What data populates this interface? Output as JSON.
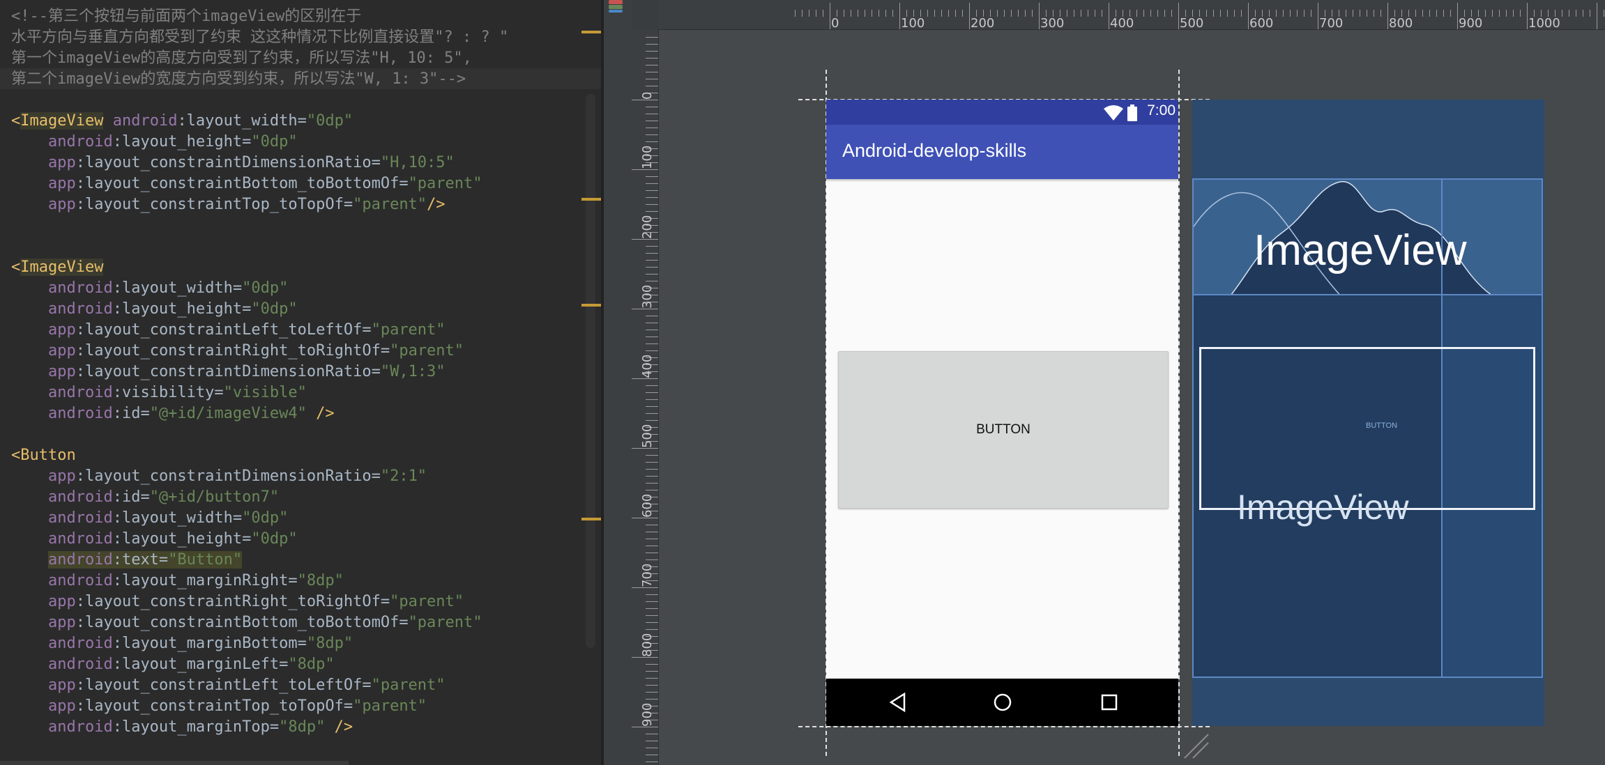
{
  "editor": {
    "lines": [
      {
        "segments": [
          {
            "t": "<!--第三个按钮与前面两个imageView的区别在于",
            "c": "comment"
          }
        ]
      },
      {
        "segments": [
          {
            "t": "水平方向与垂直方向都受到了约束 这这种情况下比例直接设置\"? : ? \"",
            "c": "comment"
          }
        ]
      },
      {
        "segments": [
          {
            "t": "第一个imageView的高度方向受到了约束，所以写法\"H, 10: 5\",",
            "c": "comment"
          }
        ]
      },
      {
        "segments": [
          {
            "t": "第二个imageView的宽度方向受到约束，所以写法\"W, 1: 3\"-->",
            "c": "comment"
          }
        ]
      },
      {
        "segments": []
      },
      {
        "segments": [
          {
            "t": "<",
            "c": "tag"
          },
          {
            "t": "ImageView",
            "c": "tag hl-word"
          },
          {
            "t": " "
          },
          {
            "t": "android",
            "c": "ns-android"
          },
          {
            "t": ":layout_width=",
            "c": "attr"
          },
          {
            "t": "\"0dp\"",
            "c": "val"
          }
        ]
      },
      {
        "segments": [
          {
            "t": "    "
          },
          {
            "t": "android",
            "c": "ns-android"
          },
          {
            "t": ":layout_height=",
            "c": "attr"
          },
          {
            "t": "\"0dp\"",
            "c": "val"
          }
        ]
      },
      {
        "segments": [
          {
            "t": "    "
          },
          {
            "t": "app",
            "c": "ns-app"
          },
          {
            "t": ":layout_constraintDimensionRatio=",
            "c": "attr"
          },
          {
            "t": "\"H,10:5\"",
            "c": "val"
          }
        ]
      },
      {
        "segments": [
          {
            "t": "    "
          },
          {
            "t": "app",
            "c": "ns-app"
          },
          {
            "t": ":layout_constraintBottom_toBottomOf=",
            "c": "attr"
          },
          {
            "t": "\"parent\"",
            "c": "val"
          }
        ]
      },
      {
        "segments": [
          {
            "t": "    "
          },
          {
            "t": "app",
            "c": "ns-app"
          },
          {
            "t": ":layout_constraintTop_toTopOf=",
            "c": "attr"
          },
          {
            "t": "\"parent\"",
            "c": "val"
          },
          {
            "t": "/>",
            "c": "tag"
          }
        ]
      },
      {
        "segments": []
      },
      {
        "segments": []
      },
      {
        "segments": [
          {
            "t": "<",
            "c": "tag"
          },
          {
            "t": "ImageView",
            "c": "tag hl-word"
          }
        ]
      },
      {
        "segments": [
          {
            "t": "    "
          },
          {
            "t": "android",
            "c": "ns-android"
          },
          {
            "t": ":layout_width=",
            "c": "attr"
          },
          {
            "t": "\"0dp\"",
            "c": "val"
          }
        ]
      },
      {
        "segments": [
          {
            "t": "    "
          },
          {
            "t": "android",
            "c": "ns-android"
          },
          {
            "t": ":layout_height=",
            "c": "attr"
          },
          {
            "t": "\"0dp\"",
            "c": "val"
          }
        ]
      },
      {
        "segments": [
          {
            "t": "    "
          },
          {
            "t": "app",
            "c": "ns-app"
          },
          {
            "t": ":layout_constraintLeft_toLeftOf=",
            "c": "attr"
          },
          {
            "t": "\"parent\"",
            "c": "val"
          }
        ]
      },
      {
        "segments": [
          {
            "t": "    "
          },
          {
            "t": "app",
            "c": "ns-app"
          },
          {
            "t": ":layout_constraintRight_toRightOf=",
            "c": "attr"
          },
          {
            "t": "\"parent\"",
            "c": "val"
          }
        ]
      },
      {
        "segments": [
          {
            "t": "    "
          },
          {
            "t": "app",
            "c": "ns-app"
          },
          {
            "t": ":layout_constraintDimensionRatio=",
            "c": "attr"
          },
          {
            "t": "\"W,1:3\"",
            "c": "val"
          }
        ]
      },
      {
        "segments": [
          {
            "t": "    "
          },
          {
            "t": "android",
            "c": "ns-android"
          },
          {
            "t": ":visibility=",
            "c": "attr"
          },
          {
            "t": "\"visible\"",
            "c": "val"
          }
        ]
      },
      {
        "segments": [
          {
            "t": "    "
          },
          {
            "t": "android",
            "c": "ns-android"
          },
          {
            "t": ":id=",
            "c": "attr"
          },
          {
            "t": "\"@+id/imageView4\"",
            "c": "val"
          },
          {
            "t": " />",
            "c": "tag"
          }
        ]
      },
      {
        "segments": []
      },
      {
        "segments": [
          {
            "t": "<",
            "c": "tag"
          },
          {
            "t": "Button",
            "c": "tag"
          }
        ]
      },
      {
        "segments": [
          {
            "t": "    "
          },
          {
            "t": "app",
            "c": "ns-app"
          },
          {
            "t": ":layout_constraintDimensionRatio=",
            "c": "attr"
          },
          {
            "t": "\"2:1\"",
            "c": "val"
          }
        ]
      },
      {
        "segments": [
          {
            "t": "    "
          },
          {
            "t": "android",
            "c": "ns-android"
          },
          {
            "t": ":id=",
            "c": "attr"
          },
          {
            "t": "\"@+id/button7\"",
            "c": "val"
          }
        ]
      },
      {
        "segments": [
          {
            "t": "    "
          },
          {
            "t": "android",
            "c": "ns-android"
          },
          {
            "t": ":layout_width=",
            "c": "attr"
          },
          {
            "t": "\"0dp\"",
            "c": "val"
          }
        ]
      },
      {
        "segments": [
          {
            "t": "    "
          },
          {
            "t": "android",
            "c": "ns-android"
          },
          {
            "t": ":layout_height=",
            "c": "attr"
          },
          {
            "t": "\"0dp\"",
            "c": "val"
          }
        ]
      },
      {
        "segments": [
          {
            "t": "    "
          },
          {
            "t": "android",
            "c": "ns-android hl-attr"
          },
          {
            "t": ":text=",
            "c": "attr hl-attr"
          },
          {
            "t": "\"Button\"",
            "c": "val hl-attr"
          }
        ]
      },
      {
        "segments": [
          {
            "t": "    "
          },
          {
            "t": "android",
            "c": "ns-android"
          },
          {
            "t": ":layout_marginRight=",
            "c": "attr"
          },
          {
            "t": "\"8dp\"",
            "c": "val"
          }
        ]
      },
      {
        "segments": [
          {
            "t": "    "
          },
          {
            "t": "app",
            "c": "ns-app"
          },
          {
            "t": ":layout_constraintRight_toRightOf=",
            "c": "attr"
          },
          {
            "t": "\"parent\"",
            "c": "val"
          }
        ]
      },
      {
        "segments": [
          {
            "t": "    "
          },
          {
            "t": "app",
            "c": "ns-app"
          },
          {
            "t": ":layout_constraintBottom_toBottomOf=",
            "c": "attr"
          },
          {
            "t": "\"parent\"",
            "c": "val"
          }
        ]
      },
      {
        "segments": [
          {
            "t": "    "
          },
          {
            "t": "android",
            "c": "ns-android"
          },
          {
            "t": ":layout_marginBottom=",
            "c": "attr"
          },
          {
            "t": "\"8dp\"",
            "c": "val"
          }
        ]
      },
      {
        "segments": [
          {
            "t": "    "
          },
          {
            "t": "android",
            "c": "ns-android"
          },
          {
            "t": ":layout_marginLeft=",
            "c": "attr"
          },
          {
            "t": "\"8dp\"",
            "c": "val"
          }
        ]
      },
      {
        "segments": [
          {
            "t": "    "
          },
          {
            "t": "app",
            "c": "ns-app"
          },
          {
            "t": ":layout_constraintLeft_toLeftOf=",
            "c": "attr"
          },
          {
            "t": "\"parent\"",
            "c": "val"
          }
        ]
      },
      {
        "segments": [
          {
            "t": "    "
          },
          {
            "t": "app",
            "c": "ns-app"
          },
          {
            "t": ":layout_constraintTop_toTopOf=",
            "c": "attr"
          },
          {
            "t": "\"parent\"",
            "c": "val"
          }
        ]
      },
      {
        "segments": [
          {
            "t": "    "
          },
          {
            "t": "android",
            "c": "ns-android"
          },
          {
            "t": ":layout_marginTop=",
            "c": "attr"
          },
          {
            "t": "\"8dp\"",
            "c": "val"
          },
          {
            "t": " />",
            "c": "tag"
          }
        ]
      }
    ]
  },
  "rulers": {
    "horizontal_labels": [
      "0",
      "100",
      "200",
      "300",
      "400",
      "500",
      "600",
      "700",
      "800",
      "900",
      "1000"
    ],
    "vertical_labels": [
      "0",
      "100",
      "200",
      "300",
      "400",
      "500",
      "600",
      "700",
      "800",
      "900"
    ]
  },
  "preview": {
    "status_time": "7:00",
    "app_title": "Android-develop-skills",
    "button_label": "BUTTON",
    "nav_icons": [
      "back-icon",
      "home-icon",
      "recents-icon"
    ],
    "colors": {
      "status_bar": "#303f9f",
      "app_bar": "#3f51b5",
      "window": "#fafafa",
      "button": "#d6d7d7"
    }
  },
  "blueprint": {
    "image1_label": "ImageView",
    "image2_label": "ImageView",
    "button_label": "BUTTON",
    "colors": {
      "background": "#2c4a6e",
      "outline": "#5e89c6"
    }
  }
}
